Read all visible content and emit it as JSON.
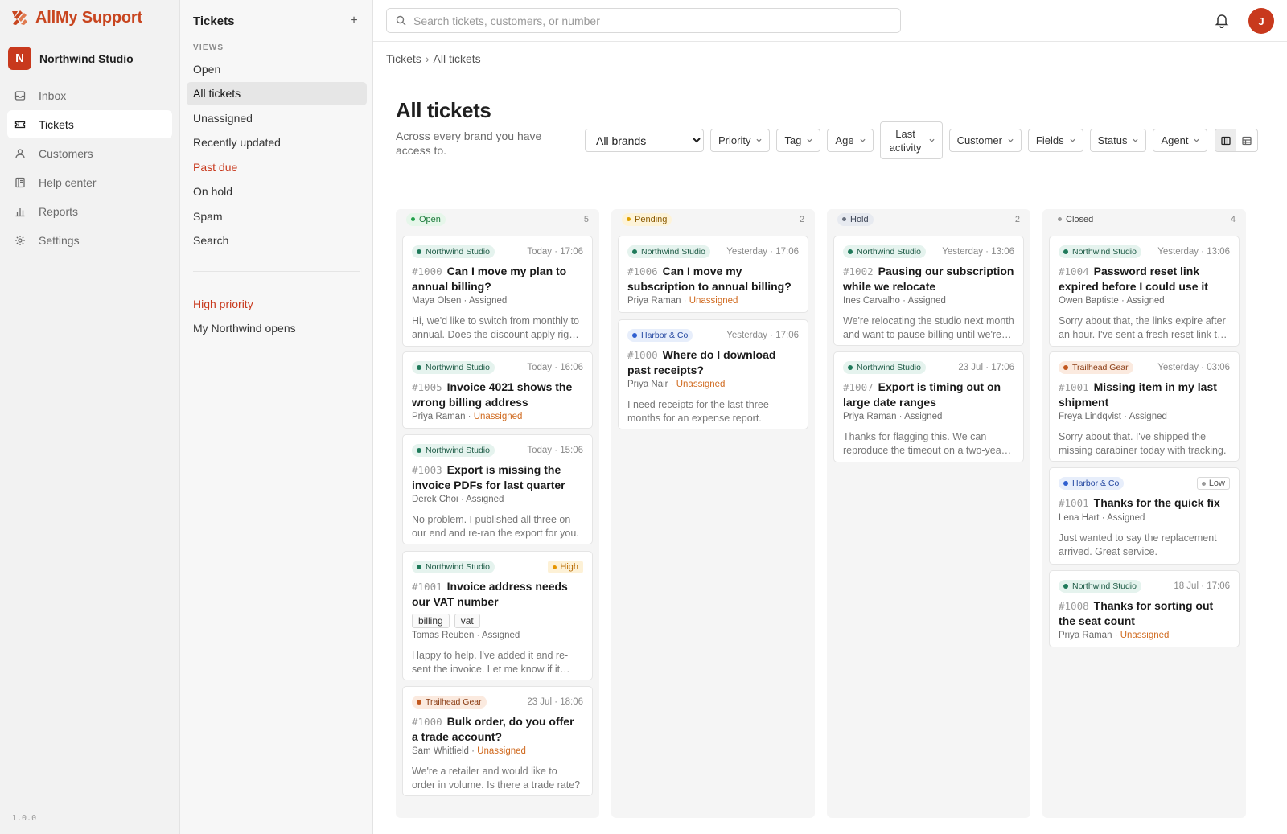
{
  "app": {
    "brand": "AllMy Support",
    "version": "1.0.0"
  },
  "org": {
    "initial": "N",
    "name": "Northwind Studio"
  },
  "nav": [
    {
      "label": "Inbox",
      "icon": "inbox-icon",
      "active": false
    },
    {
      "label": "Tickets",
      "icon": "ticket-icon",
      "active": true
    },
    {
      "label": "Customers",
      "icon": "user-icon",
      "active": false
    },
    {
      "label": "Help center",
      "icon": "book-icon",
      "active": false
    },
    {
      "label": "Reports",
      "icon": "bar-chart-icon",
      "active": false
    },
    {
      "label": "Settings",
      "icon": "gear-icon",
      "active": false
    }
  ],
  "views": {
    "title": "Tickets",
    "caption": "VIEWS",
    "items": [
      {
        "label": "Open",
        "active": false,
        "danger": false
      },
      {
        "label": "All tickets",
        "active": true,
        "danger": false
      },
      {
        "label": "Unassigned",
        "active": false,
        "danger": false
      },
      {
        "label": "Recently updated",
        "active": false,
        "danger": false
      },
      {
        "label": "Past due",
        "active": false,
        "danger": true
      },
      {
        "label": "On hold",
        "active": false,
        "danger": false
      },
      {
        "label": "Spam",
        "active": false,
        "danger": false
      },
      {
        "label": "Search",
        "active": false,
        "danger": false
      }
    ],
    "custom": [
      {
        "label": "High priority",
        "danger": true
      },
      {
        "label": "My Northwind opens",
        "danger": false
      }
    ]
  },
  "topbar": {
    "search_placeholder": "Search tickets, customers, or number",
    "user_initial": "J"
  },
  "breadcrumb": {
    "root": "Tickets",
    "sep": "›",
    "current": "All tickets"
  },
  "page": {
    "title": "All tickets",
    "subtitle": "Across every brand you have access to."
  },
  "filters": {
    "brand_selected": "All brands",
    "buttons": [
      "Priority",
      "Tag",
      "Age",
      "Last activity",
      "Customer",
      "Fields",
      "Status",
      "Agent"
    ]
  },
  "colors": {
    "accent": "#c8391d",
    "unassigned": "#d06a1f"
  },
  "columns": [
    {
      "status": "Open",
      "count": "5",
      "pill": {
        "bg": "#e6f6ea",
        "fg": "#1b7a3a",
        "dot": "#22a04b"
      },
      "cards": [
        {
          "brand": "Northwind Studio",
          "time": "Today · 17:06",
          "number": "#1000",
          "title": "Can I move my plan to annual billing?",
          "requester": "Maya Olsen",
          "assignee": "Assigned",
          "unassigned": false,
          "preview": "Hi, we'd like to switch from monthly to annual. Does the discount apply right away?"
        },
        {
          "brand": "Northwind Studio",
          "time": "Today · 16:06",
          "number": "#1005",
          "title": "Invoice 4021 shows the wrong billing address",
          "requester": "Priya Raman",
          "assignee": "Unassigned",
          "unassigned": true
        },
        {
          "brand": "Northwind Studio",
          "time": "Today · 15:06",
          "number": "#1003",
          "title": "Export is missing the invoice PDFs for last quarter",
          "requester": "Derek Choi",
          "assignee": "Assigned",
          "unassigned": false,
          "preview": "No problem. I published all three on our end and re-ran the export for you."
        },
        {
          "brand": "Northwind Studio",
          "priority": "High",
          "number": "#1001",
          "title": "Invoice address needs our VAT number",
          "tags": [
            "billing",
            "vat"
          ],
          "requester": "Tomas Reuben",
          "assignee": "Assigned",
          "unassigned": false,
          "preview": "Happy to help. I've added it and re-sent the invoice. Let me know if it looks right."
        },
        {
          "brand": "Trailhead Gear",
          "time": "23 Jul · 18:06",
          "number": "#1000",
          "title": "Bulk order, do you offer a trade account?",
          "requester": "Sam Whitfield",
          "assignee": "Unassigned",
          "unassigned": true,
          "preview": "We're a retailer and would like to order in volume. Is there a trade rate?"
        }
      ]
    },
    {
      "status": "Pending",
      "count": "2",
      "pill": {
        "bg": "#fdf3d8",
        "fg": "#8a5a00",
        "dot": "#e0a100"
      },
      "cards": [
        {
          "brand": "Northwind Studio",
          "time": "Yesterday · 17:06",
          "number": "#1006",
          "title": "Can I move my subscription to annual billing?",
          "requester": "Priya Raman",
          "assignee": "Unassigned",
          "unassigned": true
        },
        {
          "brand": "Harbor & Co",
          "time": "Yesterday · 17:06",
          "number": "#1000",
          "title": "Where do I download past receipts?",
          "requester": "Priya Nair",
          "assignee": "Unassigned",
          "unassigned": true,
          "preview": "I need receipts for the last three months for an expense report."
        }
      ]
    },
    {
      "status": "Hold",
      "count": "2",
      "pill": {
        "bg": "#e7eaf0",
        "fg": "#3e4657",
        "dot": "#6b7280"
      },
      "cards": [
        {
          "brand": "Northwind Studio",
          "time": "Yesterday · 13:06",
          "number": "#1002",
          "title": "Pausing our subscription while we relocate",
          "requester": "Ines Carvalho",
          "assignee": "Assigned",
          "unassigned": false,
          "preview": "We're relocating the studio next month and want to pause billing until we're settled."
        },
        {
          "brand": "Northwind Studio",
          "time": "23 Jul · 17:06",
          "number": "#1007",
          "title": "Export is timing out on large date ranges",
          "requester": "Priya Raman",
          "assignee": "Assigned",
          "unassigned": false,
          "preview": "Thanks for flagging this. We can reproduce the timeout on a two-year range."
        }
      ]
    },
    {
      "status": "Closed",
      "count": "4",
      "pill": {
        "bg": "transparent",
        "fg": "#444444",
        "dot": "#9a9a9a"
      },
      "cards": [
        {
          "brand": "Northwind Studio",
          "time": "Yesterday · 13:06",
          "number": "#1004",
          "title": "Password reset link expired before I could use it",
          "requester": "Owen Baptiste",
          "assignee": "Assigned",
          "unassigned": false,
          "preview": "Sorry about that, the links expire after an hour. I've sent a fresh reset link to you."
        },
        {
          "brand": "Trailhead Gear",
          "time": "Yesterday · 03:06",
          "number": "#1001",
          "title": "Missing item in my last shipment",
          "requester": "Freya Lindqvist",
          "assignee": "Assigned",
          "unassigned": false,
          "preview": "Sorry about that. I've shipped the missing carabiner today with tracking."
        },
        {
          "brand": "Harbor & Co",
          "priority": "Low",
          "number": "#1001",
          "title": "Thanks for the quick fix",
          "requester": "Lena Hart",
          "assignee": "Assigned",
          "unassigned": false,
          "preview": "Just wanted to say the replacement arrived. Great service."
        },
        {
          "brand": "Northwind Studio",
          "time": "18 Jul · 17:06",
          "number": "#1008",
          "title": "Thanks for sorting out the seat count",
          "requester": "Priya Raman",
          "assignee": "Unassigned",
          "unassigned": true
        }
      ]
    }
  ],
  "brand_styles": {
    "Northwind Studio": {
      "bg": "#e5f3ee",
      "fg": "#1e5b46",
      "dot": "#1f7a5a"
    },
    "Trailhead Gear": {
      "bg": "#fbeadf",
      "fg": "#8a3b12",
      "dot": "#c2571d"
    },
    "Harbor & Co": {
      "bg": "#e7eefb",
      "fg": "#2447a0",
      "dot": "#2f5fd0"
    }
  },
  "priority_styles": {
    "High": {
      "bg": "#fdf1d6",
      "fg": "#b86a00",
      "dot": "#e69500",
      "border": "#fdf1d6"
    },
    "Low": {
      "bg": "#ffffff",
      "fg": "#555555",
      "dot": "#9a9a9a",
      "border": "#d9d9d9"
    }
  }
}
